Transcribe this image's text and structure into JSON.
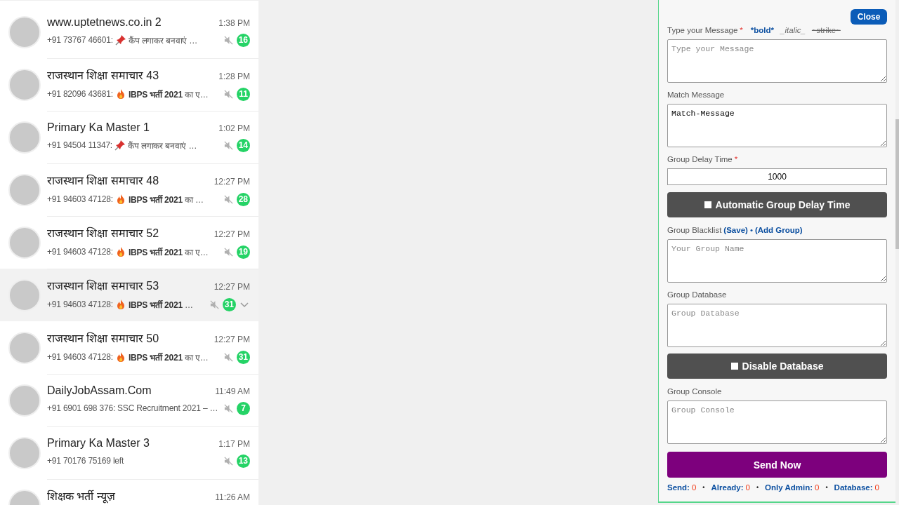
{
  "chats": [
    {
      "name": "www.uptetnews.co.in 2",
      "time": "1:38 PM",
      "sender": "+91 73767 46601:",
      "kind": "pin",
      "message": "कैंप लगाकर बनवाएं …",
      "muted": true,
      "unread": "16",
      "selected": false
    },
    {
      "name": "राजस्थान शिक्षा समाचार 43",
      "time": "1:28 PM",
      "sender": "+91 82096 43681:",
      "kind": "fire",
      "message": "**IBPS भर्ती 2021** का ए…",
      "muted": true,
      "unread": "11",
      "selected": false
    },
    {
      "name": "Primary Ka Master 1",
      "time": "1:02 PM",
      "sender": "+91 94504 11347:",
      "kind": "pin",
      "message": "कैंप लगाकर बनवाएं …",
      "muted": true,
      "unread": "14",
      "selected": false
    },
    {
      "name": "राजस्थान शिक्षा समाचार 48",
      "time": "12:27 PM",
      "sender": "+91 94603 47128:",
      "kind": "fire",
      "message": "**IBPS भर्ती 2021** का …",
      "muted": true,
      "unread": "28",
      "selected": false
    },
    {
      "name": "राजस्थान शिक्षा समाचार 52",
      "time": "12:27 PM",
      "sender": "+91 94603 47128:",
      "kind": "fire",
      "message": "**IBPS भर्ती 2021** का ए…",
      "muted": true,
      "unread": "19",
      "selected": false
    },
    {
      "name": "राजस्थान शिक्षा समाचार 53",
      "time": "12:27 PM",
      "sender": "+91 94603 47128:",
      "kind": "fire",
      "message": "**IBPS भर्ती 2021** …",
      "muted": true,
      "unread": "31",
      "selected": true
    },
    {
      "name": "राजस्थान शिक्षा समाचार 50",
      "time": "12:27 PM",
      "sender": "+91 94603 47128:",
      "kind": "fire",
      "message": "**IBPS भर्ती 2021** का ए…",
      "muted": true,
      "unread": "31",
      "selected": false
    },
    {
      "name": "DailyJobAssam.Com",
      "time": "11:49 AM",
      "sender": "+91 6901 698 376:",
      "kind": "plain",
      "message": "SSC Recruitment 2021 – …",
      "muted": true,
      "unread": "7",
      "selected": false
    },
    {
      "name": "Primary Ka Master 3",
      "time": "1:17 PM",
      "sender": "+91 70176 75169 left",
      "kind": "plain",
      "muted": true,
      "unread": "13",
      "selected": false
    },
    {
      "name": "शिक्षक भर्ती न्यूज़",
      "time": "11:26 AM",
      "kind": "plain",
      "selected": false
    }
  ],
  "panel": {
    "close": "Close",
    "message": {
      "label": "Type your Message",
      "required_mark": "*",
      "placeholder": "Type your Message",
      "format_hints": [
        {
          "kind": "bold",
          "text": "*bold*"
        },
        {
          "kind": "italic",
          "text": "_italic_"
        },
        {
          "kind": "strike",
          "text": "~strike~"
        }
      ]
    },
    "match": {
      "label": "Match Message",
      "value": "Match-Message"
    },
    "delay": {
      "label": "Group Delay Time",
      "required_mark": "*",
      "value": "1000"
    },
    "auto_delay": {
      "label": "Automatic Group Delay Time",
      "checked": false
    },
    "blacklist": {
      "label": "Group Blacklist",
      "links": [
        "(Save)",
        "(Add Group)"
      ],
      "separator": "•",
      "placeholder": "Your Group Name"
    },
    "database": {
      "label": "Group Database",
      "placeholder": "Group Database"
    },
    "disable_db": {
      "label": "Disable Database",
      "checked": false
    },
    "console": {
      "label": "Group Console",
      "placeholder": "Group Console"
    },
    "send": "Send Now",
    "stats": [
      {
        "label": "Send:",
        "value": "0"
      },
      {
        "label": "Already:",
        "value": "0"
      },
      {
        "label": "Only Admin:",
        "value": "0"
      },
      {
        "label": "Database:",
        "value": "0"
      }
    ],
    "stats_separator": "•"
  }
}
